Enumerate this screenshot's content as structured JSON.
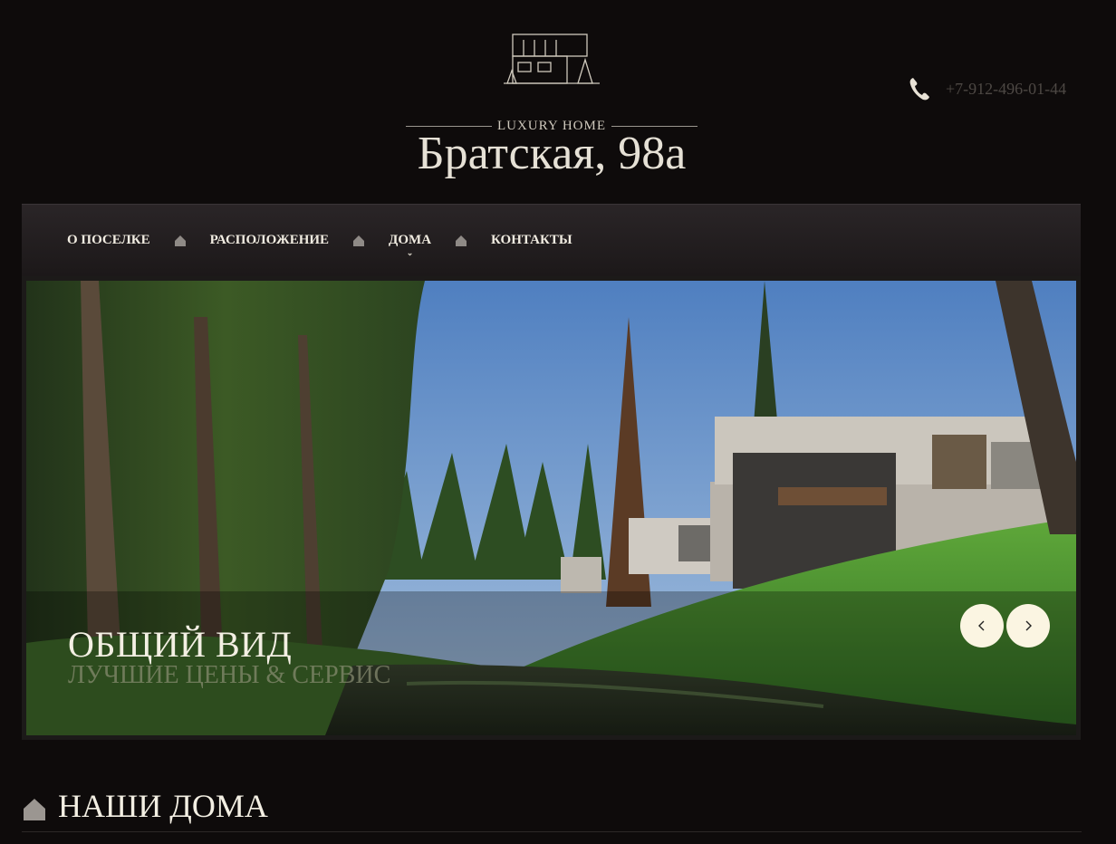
{
  "header": {
    "logo_subtitle": "LUXURY HOME",
    "logo_title": "Братская, 98а",
    "phone": "+7-912-496-01-44"
  },
  "nav": {
    "items": [
      {
        "label": "О ПОСЕЛКЕ"
      },
      {
        "label": "РАСПОЛОЖЕНИЕ"
      },
      {
        "label": "ДОМА",
        "has_dropdown": true
      },
      {
        "label": "КОНТАКТЫ"
      }
    ]
  },
  "slider": {
    "title": "ОБЩИЙ ВИД",
    "subtitle": "ЛУЧШИЕ ЦЕНЫ & СЕРВИС",
    "prev_icon": "chevron-left-icon",
    "next_icon": "chevron-right-icon"
  },
  "section": {
    "icon": "house-icon",
    "title": "НАШИ ДОМА"
  },
  "colors": {
    "background": "#0e0b0b",
    "nav_background": "#231f20",
    "accent_button": "#fbf5e2",
    "text": "#f3efe3"
  }
}
